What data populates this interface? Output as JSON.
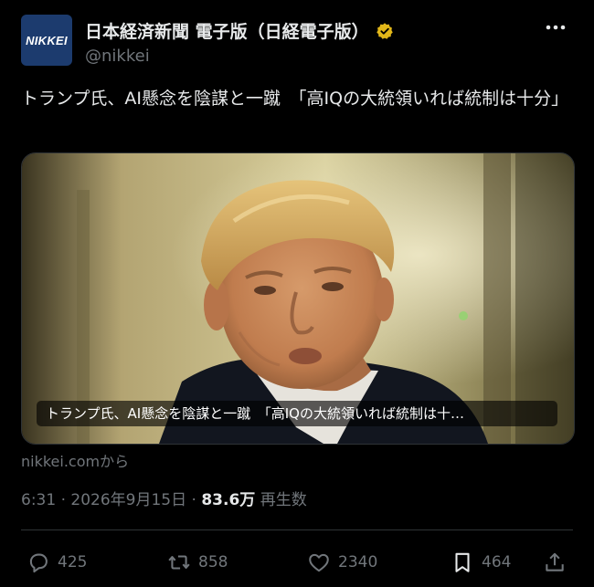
{
  "account": {
    "avatar_text": "NIKKEI",
    "display_name": "日本経済新聞 電子版（日経電子版）",
    "handle": "@nikkei",
    "verified_badge_color": "#e2b719",
    "avatar_color": "#1c3b6e"
  },
  "post": {
    "text": "トランプ氏、AI懸念を陰謀と一蹴　「高IQの大統領いれば統制は十分」"
  },
  "card": {
    "caption": "トランプ氏、AI懸念を陰謀と一蹴　「高IQの大統領いれば統制は十…",
    "source": "nikkei.comから"
  },
  "meta": {
    "time": "6:31",
    "separator1": " · ",
    "date": "2026年9月15日",
    "separator2": " · ",
    "views": "83.6万",
    "views_label": " 再生数"
  },
  "actions": {
    "replies": "425",
    "reposts": "858",
    "likes": "2340",
    "bookmarks": "464"
  },
  "icons": [
    "verified-badge-icon",
    "more-icon",
    "reply-icon",
    "repost-icon",
    "like-icon",
    "bookmark-icon",
    "share-icon"
  ]
}
